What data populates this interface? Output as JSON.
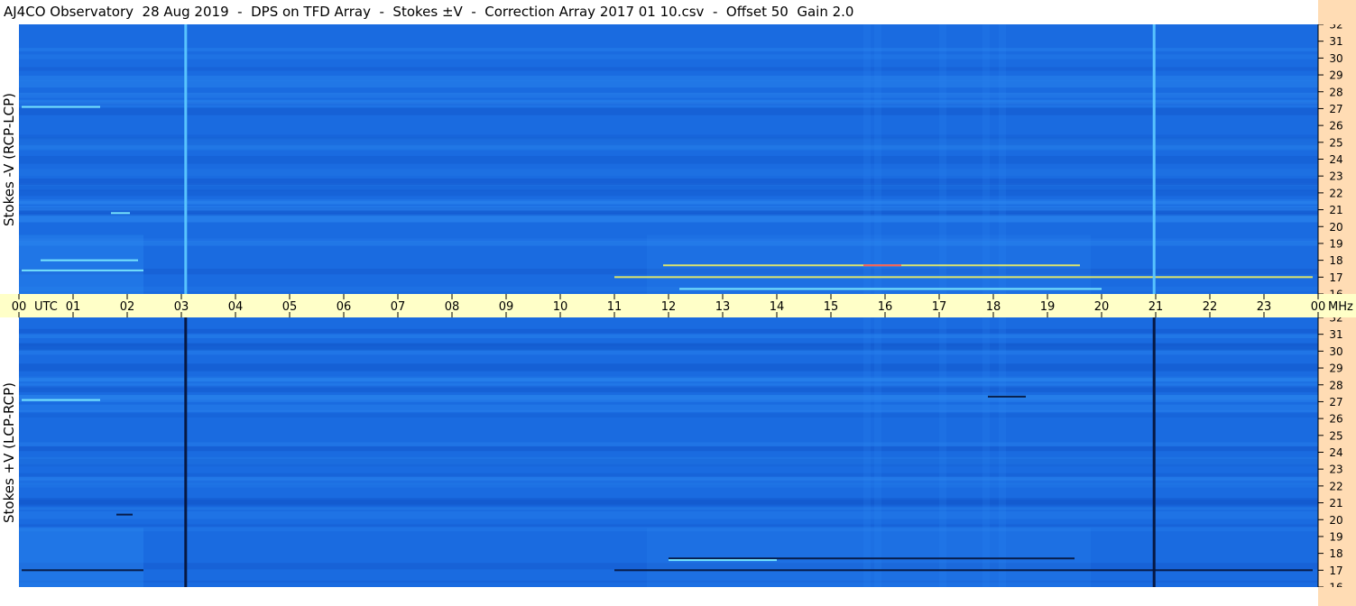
{
  "title": "AJ4CO Observatory  28 Aug 2019  -  DPS on TFD Array  -  Stokes ±V  -  Correction Array 2017 01 10.csv  -  Offset 50  Gain 2.0",
  "colors": {
    "panel_background": "#1a6be0",
    "panel_band_light": "#2f8cf2",
    "panel_band_dark": "#104fc4",
    "axis_strip": "#ffffc8",
    "frequency_strip": "#ffdcb4",
    "burst_cyan": "#7ff0ff",
    "burst_yellow": "#f0f060",
    "burst_red": "#ff5050",
    "dark_line": "#06143a",
    "cyan_line": "#5cc8ff"
  },
  "chart_data": {
    "type": "heatmap",
    "x_unit": "UTC",
    "x_tick_labels": [
      "00",
      "01",
      "02",
      "03",
      "04",
      "05",
      "06",
      "07",
      "08",
      "09",
      "10",
      "11",
      "12",
      "13",
      "14",
      "15",
      "16",
      "17",
      "18",
      "19",
      "20",
      "21",
      "22",
      "23",
      "00"
    ],
    "x_range_hours": [
      0,
      24
    ],
    "y_unit": "MHz",
    "y_range_mhz": [
      16,
      32
    ],
    "y_tick_labels": [
      "32",
      "31",
      "30",
      "29",
      "28",
      "27",
      "26",
      "25",
      "24",
      "23",
      "22",
      "21",
      "20",
      "19",
      "18",
      "17",
      "16"
    ],
    "panels": [
      {
        "ylabel": "Stokes -V (RCP-LCP)",
        "polarity": "negative",
        "vertical_lines_utc": [
          3.08,
          20.97
        ],
        "features": [
          {
            "start_utc": 0.05,
            "end_utc": 1.5,
            "freq_mhz": 27.1,
            "color": "cyan"
          },
          {
            "start_utc": 1.7,
            "end_utc": 2.05,
            "freq_mhz": 20.8,
            "color": "cyan"
          },
          {
            "start_utc": 0.05,
            "end_utc": 2.3,
            "freq_mhz": 17.4,
            "color": "cyan"
          },
          {
            "start_utc": 0.4,
            "end_utc": 2.2,
            "freq_mhz": 18.0,
            "color": "cyan"
          },
          {
            "start_utc": 11.9,
            "end_utc": 19.6,
            "freq_mhz": 17.7,
            "color": "yellow"
          },
          {
            "start_utc": 11.0,
            "end_utc": 23.9,
            "freq_mhz": 17.0,
            "color": "yellow"
          },
          {
            "start_utc": 15.6,
            "end_utc": 16.3,
            "freq_mhz": 17.7,
            "color": "red"
          },
          {
            "start_utc": 12.2,
            "end_utc": 20.0,
            "freq_mhz": 16.3,
            "color": "cyan"
          }
        ]
      },
      {
        "ylabel": "Stokes +V (LCP-RCP)",
        "polarity": "positive",
        "vertical_lines_utc": [
          3.08,
          20.97
        ],
        "features": [
          {
            "start_utc": 0.05,
            "end_utc": 1.5,
            "freq_mhz": 27.1,
            "color": "cyan"
          },
          {
            "start_utc": 1.8,
            "end_utc": 2.1,
            "freq_mhz": 20.3,
            "color": "dark"
          },
          {
            "start_utc": 0.05,
            "end_utc": 2.3,
            "freq_mhz": 17.0,
            "color": "dark"
          },
          {
            "start_utc": 12.0,
            "end_utc": 19.5,
            "freq_mhz": 17.7,
            "color": "dark"
          },
          {
            "start_utc": 11.0,
            "end_utc": 23.9,
            "freq_mhz": 17.0,
            "color": "dark"
          },
          {
            "start_utc": 12.0,
            "end_utc": 14.0,
            "freq_mhz": 17.6,
            "color": "cyan"
          },
          {
            "start_utc": 17.9,
            "end_utc": 18.6,
            "freq_mhz": 27.3,
            "color": "dark"
          }
        ]
      }
    ]
  }
}
